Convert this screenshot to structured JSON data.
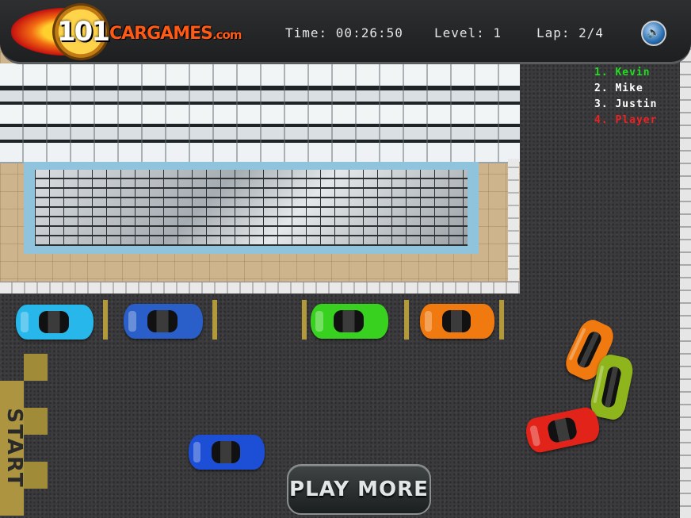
{
  "hud": {
    "logo_number": "101",
    "logo_text": "CARGAMES",
    "logo_suffix": ".com",
    "time": "Time: 00:26:50",
    "level": "Level: 1",
    "lap": "Lap: 2/4",
    "sound_icon": "speaker-icon"
  },
  "ranking": [
    {
      "label": "1. Kevin",
      "color": "#22dd22"
    },
    {
      "label": "2. Mike",
      "color": "#ffffff"
    },
    {
      "label": "3. Justin",
      "color": "#ffffff"
    },
    {
      "label": "4. Player",
      "color": "#ee2222"
    }
  ],
  "track": {
    "start_label": "START"
  },
  "buttons": {
    "play_more": "PLAY MORE"
  },
  "colors": {
    "car_cyan": "#28b7ea",
    "car_blue": "#2a5fc9",
    "car_green": "#39d11f",
    "car_orange": "#f07a10",
    "car_player": "#1c4ed6",
    "car_red": "#e2231a",
    "car_lime": "#8fb51c"
  }
}
